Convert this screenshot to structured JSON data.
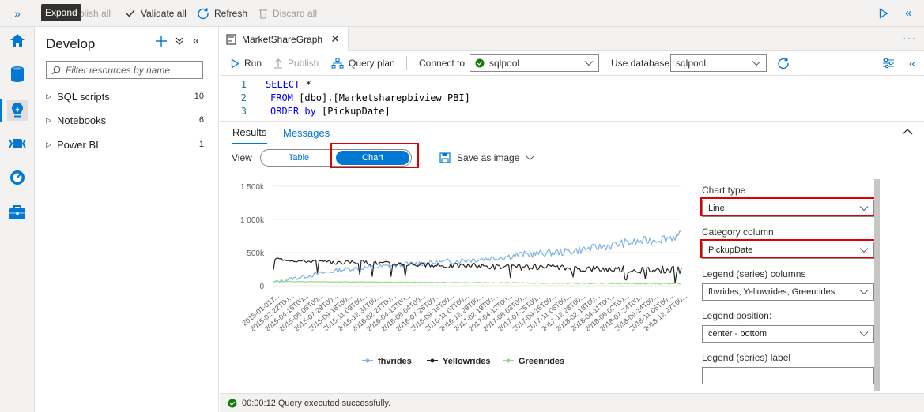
{
  "topbar": {
    "expand_tooltip": "Expand",
    "publish_all": "blish all",
    "validate_all": "Validate all",
    "refresh": "Refresh",
    "discard_all": "Discard all"
  },
  "develop": {
    "title": "Develop",
    "filter_placeholder": "Filter resources by name",
    "items": [
      {
        "label": "SQL scripts",
        "count": "10"
      },
      {
        "label": "Notebooks",
        "count": "6"
      },
      {
        "label": "Power BI",
        "count": "1"
      }
    ]
  },
  "editor": {
    "tab_title": "MarketShareGraph",
    "toolbar": {
      "run": "Run",
      "publish": "Publish",
      "query_plan": "Query plan",
      "connect_to_label": "Connect to",
      "connect_to_value": "sqlpool",
      "use_database_label": "Use database",
      "use_database_value": "sqlpool"
    },
    "code": [
      {
        "num": "1",
        "kw": "SELECT",
        "rest": " *"
      },
      {
        "num": "2",
        "kw": "FROM",
        "rest": " [dbo].[Marketsharepbiview_PBI]"
      },
      {
        "num": "3",
        "kw": "ORDER by",
        "rest": " [PickupDate]"
      }
    ]
  },
  "results": {
    "tab_results": "Results",
    "tab_messages": "Messages",
    "view_label": "View",
    "toggle_table": "Table",
    "toggle_chart": "Chart",
    "save_as_image": "Save as image"
  },
  "chart_data": {
    "type": "line",
    "title": "",
    "xlabel": "",
    "ylabel": "",
    "ylim": [
      0,
      1500000
    ],
    "y_ticks": [
      "0",
      "500k",
      "1 000k",
      "1 500k"
    ],
    "y_tick_values": [
      0,
      500000,
      1000000,
      1500000
    ],
    "x_tick_labels": [
      "2015-01-01T...",
      "2015-02-22T00...",
      "2015-04-15T00...",
      "2015-06-06T00...",
      "2015-07-28T00...",
      "2015-09-18T00...",
      "2015-11-09T00...",
      "2015-12-31T00...",
      "2016-02-21T00...",
      "2016-04-13T00...",
      "2016-06-04T00...",
      "2016-07-26T00...",
      "2016-09-16T00...",
      "2016-11-07T00...",
      "2016-12-29T00...",
      "2017-02-19T00...",
      "2017-04-12T00...",
      "2017-06-03T00...",
      "2017-07-25T00...",
      "2017-09-15T00...",
      "2017-11-06T00...",
      "2017-12-28T00...",
      "2018-02-18T00...",
      "2018-04-11T00...",
      "2018-06-02T00...",
      "2018-07-24T00...",
      "2018-09-14T00...",
      "2018-11-05T00...",
      "2018-12-27T00..."
    ],
    "legend_position": "bottom-center",
    "series": [
      {
        "name": "fhvrides",
        "color": "#7fb2e5",
        "values": [
          50000,
          95000,
          135000,
          175000,
          215000,
          250000,
          270000,
          280000,
          300000,
          320000,
          340000,
          345000,
          365000,
          385000,
          400000,
          420000,
          440000,
          470000,
          480000,
          500000,
          510000,
          540000,
          570000,
          600000,
          640000,
          660000,
          690000,
          720000,
          760000
        ]
      },
      {
        "name": "Yellowrides",
        "color": "#252423",
        "values": [
          410000,
          395000,
          370000,
          370000,
          345000,
          355000,
          360000,
          345000,
          335000,
          330000,
          320000,
          300000,
          300000,
          305000,
          300000,
          290000,
          280000,
          280000,
          270000,
          275000,
          270000,
          260000,
          260000,
          255000,
          250000,
          245000,
          245000,
          240000,
          240000
        ]
      },
      {
        "name": "Greenrides",
        "color": "#8fe07f",
        "values": [
          65000,
          63000,
          62000,
          60000,
          58000,
          57000,
          56000,
          55000,
          54000,
          52000,
          51000,
          50000,
          48000,
          47000,
          46000,
          45000,
          44000,
          42000,
          41000,
          40000,
          39000,
          38000,
          37000,
          36000,
          35000,
          34000,
          33000,
          32000,
          31000
        ]
      }
    ]
  },
  "settings": {
    "chart_type_label": "Chart type",
    "chart_type_value": "Line",
    "category_column_label": "Category column",
    "category_column_value": "PickupDate",
    "legend_series_columns_label": "Legend (series) columns",
    "legend_series_columns_value": "fhvrides, Yellowrides, Greenrides",
    "legend_position_label": "Legend position:",
    "legend_position_value": "center - bottom",
    "legend_series_label_label": "Legend (series) label",
    "legend_series_label_value": ""
  },
  "status": {
    "message": "00:00:12 Query executed successfully."
  },
  "colors": {
    "accent": "#0078d4",
    "highlight_box": "#e00000",
    "success": "#107c10"
  }
}
